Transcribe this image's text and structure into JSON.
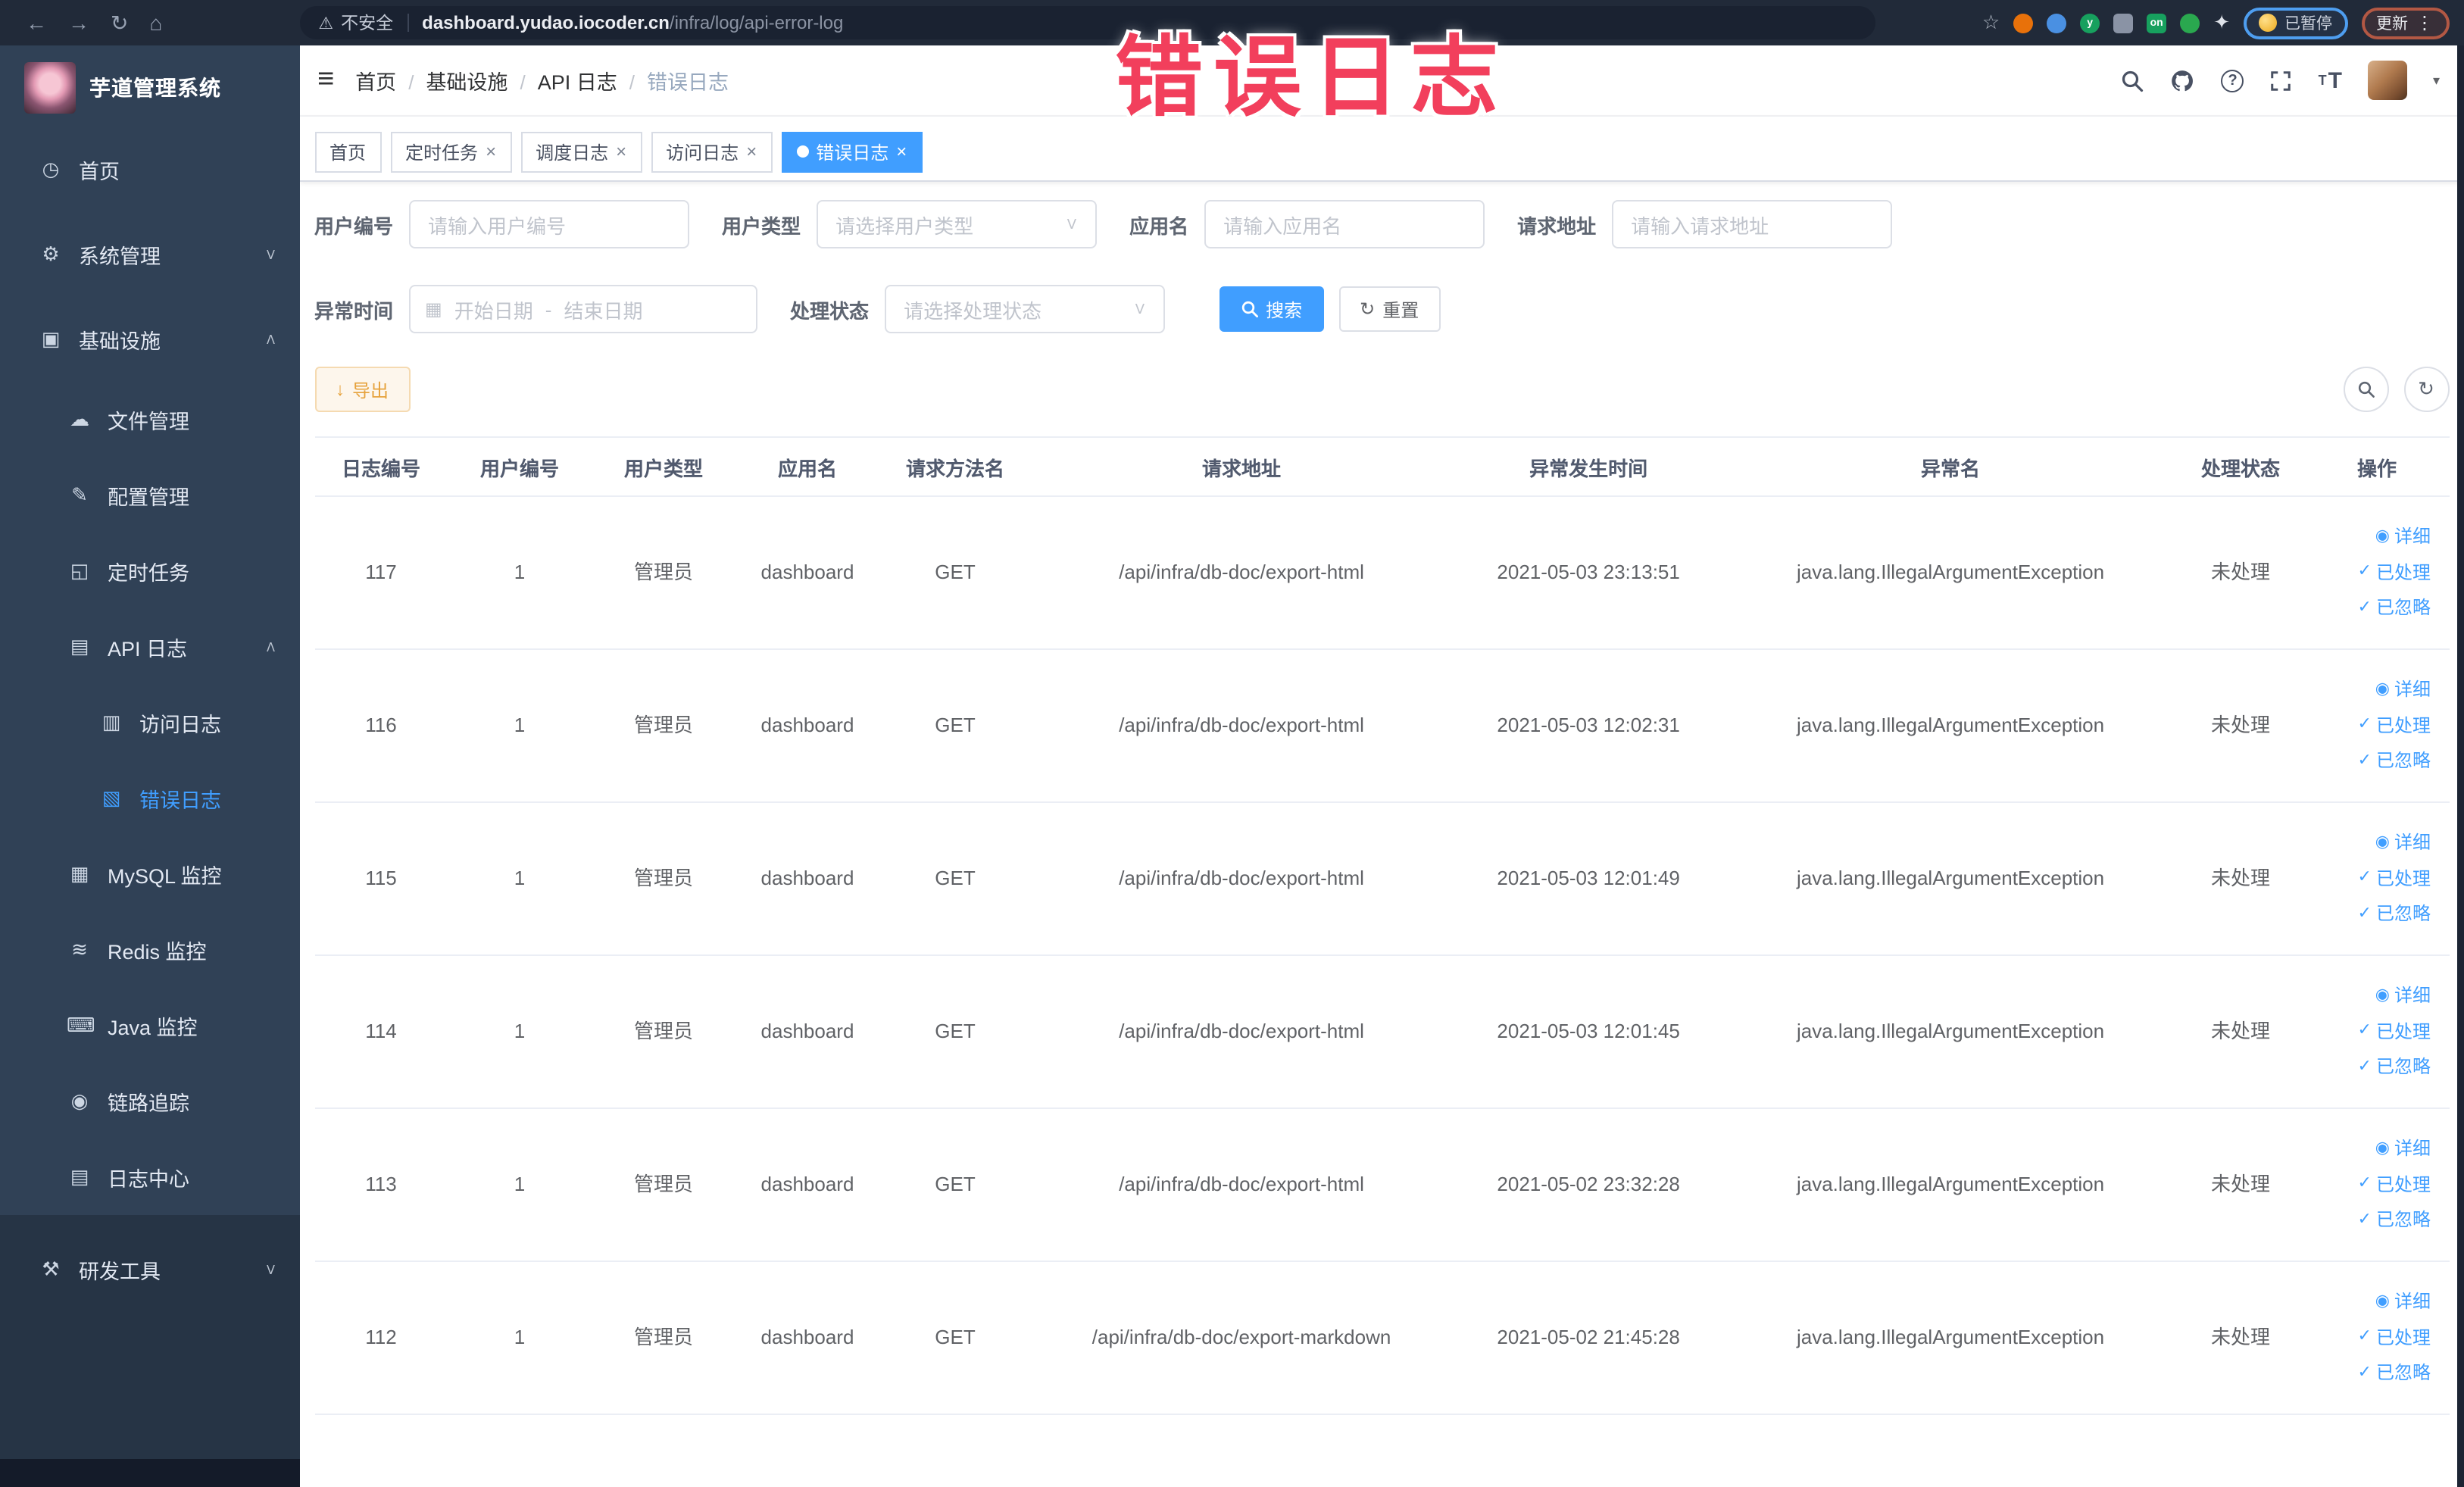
{
  "overlay": {
    "stamp_text": "错误日志"
  },
  "browser": {
    "security_label": "不安全",
    "url_host": "dashboard.yudao.iocoder.cn",
    "url_path": "/infra/log/api-error-log",
    "paused_badge_label": "已暂停",
    "update_badge_label": "更新",
    "extensions": [
      {
        "name": "orange-extension-icon",
        "color": "#e8710a",
        "shape": "circle",
        "label": ""
      },
      {
        "name": "shield-extension-icon",
        "color": "#4a90e2",
        "shape": "circle",
        "label": ""
      },
      {
        "name": "green-y-extension-icon",
        "color": "#17a05e",
        "shape": "circle",
        "label": "y"
      },
      {
        "name": "grid-extension-icon",
        "color": "#8a93a5",
        "shape": "square",
        "label": ""
      },
      {
        "name": "on-badge-extension-icon",
        "color": "#17a05e",
        "shape": "square",
        "label": "on"
      },
      {
        "name": "leaf-extension-icon",
        "color": "#2aa84f",
        "shape": "circle",
        "label": ""
      }
    ]
  },
  "sidebar": {
    "logo_title": "芋道管理系统",
    "items": [
      {
        "label": "首页",
        "icon": "dashboard-icon",
        "level": 0
      },
      {
        "label": "系统管理",
        "icon": "gear-icon",
        "level": 0,
        "chevron": "down"
      },
      {
        "label": "基础设施",
        "icon": "infra-icon",
        "level": 0,
        "chevron": "up"
      },
      {
        "label": "文件管理",
        "icon": "file-icon",
        "level": 1
      },
      {
        "label": "配置管理",
        "icon": "config-icon",
        "level": 1
      },
      {
        "label": "定时任务",
        "icon": "task-icon",
        "level": 1
      },
      {
        "label": "API 日志",
        "icon": "api-log-icon",
        "level": 1,
        "chevron": "up"
      },
      {
        "label": "访问日志",
        "icon": "access-log-icon",
        "level": 2
      },
      {
        "label": "错误日志",
        "icon": "error-log-icon",
        "level": 2,
        "active": true
      },
      {
        "label": "MySQL 监控",
        "icon": "mysql-icon",
        "level": 1
      },
      {
        "label": "Redis 监控",
        "icon": "redis-icon",
        "level": 1
      },
      {
        "label": "Java 监控",
        "icon": "java-icon",
        "level": 1
      },
      {
        "label": "链路追踪",
        "icon": "trace-icon",
        "level": 1
      },
      {
        "label": "日志中心",
        "icon": "log-center-icon",
        "level": 1
      },
      {
        "label": "研发工具",
        "icon": "devtools-icon",
        "level": 0,
        "chevron": "down",
        "dark": true
      }
    ]
  },
  "header": {
    "breadcrumb": [
      "首页",
      "基础设施",
      "API 日志",
      "错误日志"
    ]
  },
  "tabs": [
    {
      "label": "首页",
      "closable": false,
      "active": false
    },
    {
      "label": "定时任务",
      "closable": true,
      "active": false
    },
    {
      "label": "调度日志",
      "closable": true,
      "active": false
    },
    {
      "label": "访问日志",
      "closable": true,
      "active": false
    },
    {
      "label": "错误日志",
      "closable": true,
      "active": true
    }
  ],
  "filters": {
    "fields_row1": [
      {
        "name": "user-id",
        "label": "用户编号",
        "type": "input",
        "placeholder": "请输入用户编号"
      },
      {
        "name": "user-type",
        "label": "用户类型",
        "type": "select",
        "placeholder": "请选择用户类型"
      },
      {
        "name": "app-name",
        "label": "应用名",
        "type": "input",
        "placeholder": "请输入应用名"
      },
      {
        "name": "request-url",
        "label": "请求地址",
        "type": "input",
        "placeholder": "请输入请求地址"
      }
    ],
    "fields_row2": [
      {
        "name": "exception-time",
        "label": "异常时间",
        "type": "daterange",
        "placeholder_start": "开始日期",
        "separator": "-",
        "placeholder_end": "结束日期"
      },
      {
        "name": "process-status",
        "label": "处理状态",
        "type": "select",
        "placeholder": "请选择处理状态"
      }
    ],
    "search_label": "搜索",
    "reset_label": "重置"
  },
  "toolbar": {
    "export_label": "导出"
  },
  "table": {
    "columns": [
      {
        "key": "log_id",
        "label": "日志编号"
      },
      {
        "key": "user_id",
        "label": "用户编号"
      },
      {
        "key": "user_type",
        "label": "用户类型"
      },
      {
        "key": "app_name",
        "label": "应用名"
      },
      {
        "key": "method",
        "label": "请求方法名"
      },
      {
        "key": "url",
        "label": "请求地址"
      },
      {
        "key": "time",
        "label": "异常发生时间"
      },
      {
        "key": "exception",
        "label": "异常名"
      },
      {
        "key": "status",
        "label": "处理状态"
      },
      {
        "key": "actions",
        "label": "操作"
      }
    ],
    "rows": [
      {
        "log_id": "117",
        "user_id": "1",
        "user_type": "管理员",
        "app_name": "dashboard",
        "method": "GET",
        "url": "/api/infra/db-doc/export-html",
        "time": "2021-05-03 23:13:51",
        "exception": "java.lang.IllegalArgumentException",
        "status": "未处理"
      },
      {
        "log_id": "116",
        "user_id": "1",
        "user_type": "管理员",
        "app_name": "dashboard",
        "method": "GET",
        "url": "/api/infra/db-doc/export-html",
        "time": "2021-05-03 12:02:31",
        "exception": "java.lang.IllegalArgumentException",
        "status": "未处理"
      },
      {
        "log_id": "115",
        "user_id": "1",
        "user_type": "管理员",
        "app_name": "dashboard",
        "method": "GET",
        "url": "/api/infra/db-doc/export-html",
        "time": "2021-05-03 12:01:49",
        "exception": "java.lang.IllegalArgumentException",
        "status": "未处理"
      },
      {
        "log_id": "114",
        "user_id": "1",
        "user_type": "管理员",
        "app_name": "dashboard",
        "method": "GET",
        "url": "/api/infra/db-doc/export-html",
        "time": "2021-05-03 12:01:45",
        "exception": "java.lang.IllegalArgumentException",
        "status": "未处理"
      },
      {
        "log_id": "113",
        "user_id": "1",
        "user_type": "管理员",
        "app_name": "dashboard",
        "method": "GET",
        "url": "/api/infra/db-doc/export-html",
        "time": "2021-05-02 23:32:28",
        "exception": "java.lang.IllegalArgumentException",
        "status": "未处理"
      },
      {
        "log_id": "112",
        "user_id": "1",
        "user_type": "管理员",
        "app_name": "dashboard",
        "method": "GET",
        "url": "/api/infra/db-doc/export-markdown",
        "time": "2021-05-02 21:45:28",
        "exception": "java.lang.IllegalArgumentException",
        "status": "未处理"
      }
    ],
    "row_actions": [
      {
        "name": "detail-link",
        "icon": "eye-icon",
        "label": "详细"
      },
      {
        "name": "processed-link",
        "icon": "check-icon",
        "label": "已处理"
      },
      {
        "name": "ignored-link",
        "icon": "check-icon",
        "label": "已忽略"
      }
    ]
  },
  "icon_glyphs": {
    "back-icon": "←",
    "forward-icon": "→",
    "reload-icon": "↻",
    "home-icon": "⌂",
    "warning-icon": "⚠",
    "bookmark-star-icon": "☆",
    "kebab-menu-icon": "⋮",
    "puzzle-extension-icon": "✦",
    "hamburger-icon": "≡",
    "help-icon": "?",
    "font-size-icon": "T",
    "caret-down-icon": "▾",
    "dashboard-icon": "◷",
    "gear-icon": "⚙",
    "infra-icon": "▣",
    "file-icon": "☁",
    "config-icon": "✎",
    "task-icon": "◱",
    "api-log-icon": "▤",
    "access-log-icon": "▥",
    "error-log-icon": "▧",
    "mysql-icon": "▦",
    "redis-icon": "≋",
    "java-icon": "⌨",
    "trace-icon": "◉",
    "log-center-icon": "▤",
    "devtools-icon": "⚒",
    "chevron-up-icon": "ᐱ",
    "chevron-down-icon": "ᐯ",
    "calendar-icon": "▦",
    "refresh-icon": "↻",
    "download-icon": "↓",
    "eye-icon": "◉",
    "check-icon": "✓",
    "close-icon": "×"
  },
  "colors": {
    "primary": "#409eff",
    "warning": "#e6a23c",
    "sidebar_bg": "#304156",
    "sidebar_dark": "#263445",
    "stamp": "#f23f5c",
    "active_tab_bg": "#409eff",
    "chrome_bg": "#212a39"
  }
}
